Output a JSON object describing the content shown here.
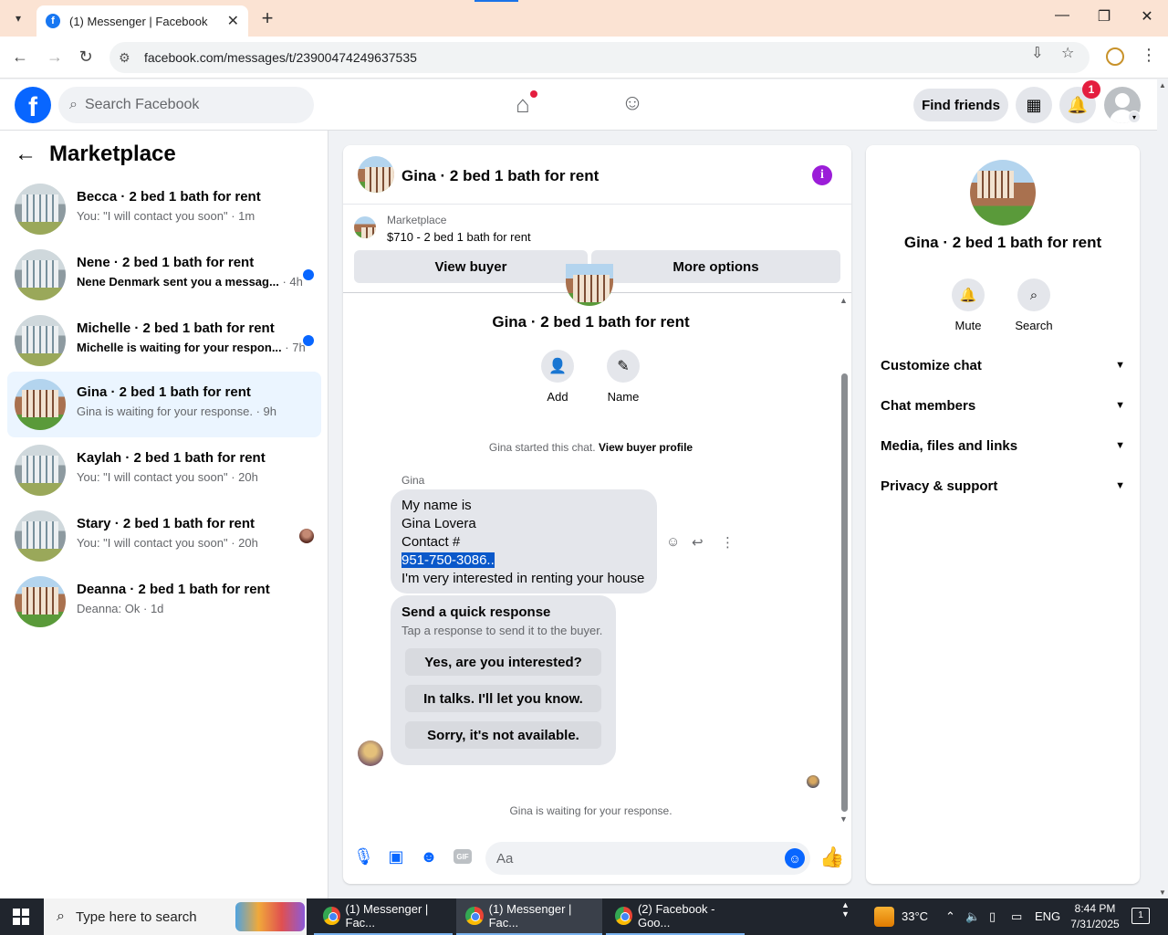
{
  "browser": {
    "tab_title": "(1) Messenger | Facebook",
    "url": "facebook.com/messages/t/23900474249637535",
    "favicon_letter": "f"
  },
  "facebook": {
    "logo_letter": "f",
    "search_placeholder": "Search Facebook",
    "find_friends_label": "Find friends",
    "notification_count": "1"
  },
  "sidebar": {
    "title": "Marketplace",
    "conversations": [
      {
        "name": "Becca · 2 bed 1 bath for rent",
        "preview": "You: \"I will contact you soon\"",
        "time": "· 1m",
        "unread": false,
        "thumb": "house"
      },
      {
        "name": "Nene · 2 bed 1 bath for rent",
        "preview": "Nene Denmark sent you a messag...",
        "time": "· 4h",
        "unread": true,
        "thumb": "house"
      },
      {
        "name": "Michelle · 2 bed 1 bath for rent",
        "preview": "Michelle is waiting for your respon...",
        "time": "· 7h",
        "unread": true,
        "thumb": "house"
      },
      {
        "name": "Gina · 2 bed 1 bath for rent",
        "preview": "Gina is waiting for your response.",
        "time": "· 9h",
        "unread": false,
        "active": true,
        "thumb": "gina"
      },
      {
        "name": "Kaylah · 2 bed 1 bath for rent",
        "preview": "You: \"I will contact you soon\"",
        "time": "· 20h",
        "unread": false,
        "thumb": "house"
      },
      {
        "name": "Stary · 2 bed 1 bath for rent",
        "preview": "You: \"I will contact you soon\"",
        "time": "· 20h",
        "unread": false,
        "seen": true,
        "thumb": "house"
      },
      {
        "name": "Deanna · 2 bed 1 bath for rent",
        "preview": "Deanna: Ok",
        "time": "· 1d",
        "unread": false,
        "thumb": "gina"
      }
    ]
  },
  "chat": {
    "title": "Gina · 2 bed 1 bath for rent",
    "marketplace_label": "Marketplace",
    "listing": "$710 - 2 bed 1 bath for rent",
    "view_buyer": "View buyer",
    "more_options": "More options",
    "profile_name": "Gina · 2 bed 1 bath for rent",
    "add_label": "Add",
    "name_label": "Name",
    "started_text": "Gina started this chat.",
    "view_buyer_profile": "View buyer profile",
    "sender": "Gina",
    "message_lines": [
      "My name is",
      "Gina Lovera",
      "Contact #",
      "951-750-3086..",
      "I'm very interested in renting your house"
    ],
    "quick_title": "Send a quick response",
    "quick_subtitle": "Tap a response to send it to the buyer.",
    "quick_responses": [
      "Yes, are you interested?",
      "In talks. I'll let you know.",
      "Sorry, it's not available."
    ],
    "waiting_text": "Gina is waiting for your response.",
    "composer_placeholder": "Aa"
  },
  "info_panel": {
    "name": "Gina · 2 bed 1 bath for rent",
    "mute_label": "Mute",
    "search_label": "Search",
    "sections": [
      "Customize chat",
      "Chat members",
      "Media, files and links",
      "Privacy & support"
    ]
  },
  "taskbar": {
    "search_placeholder": "Type here to search",
    "apps": [
      "(1) Messenger | Fac...",
      "(1) Messenger | Fac...",
      "(2) Facebook - Goo..."
    ],
    "temperature": "33°C",
    "language": "ENG",
    "time": "8:44 PM",
    "date": "7/31/2025",
    "notification_count": "1"
  },
  "colors": {
    "facebook_blue": "#0866ff",
    "info_purple": "#9b1dd8",
    "active_conversation": "#ebf5ff"
  }
}
